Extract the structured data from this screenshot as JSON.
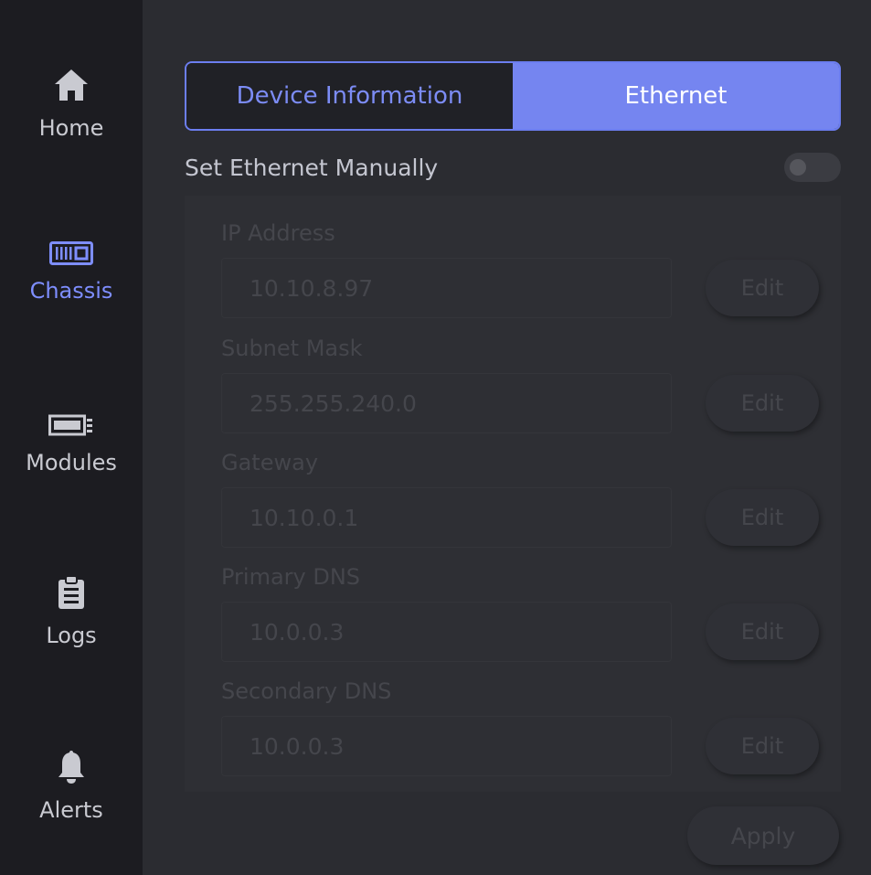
{
  "sidebar": {
    "items": [
      {
        "label": "Home",
        "icon": "home-icon"
      },
      {
        "label": "Chassis",
        "icon": "chassis-icon"
      },
      {
        "label": "Modules",
        "icon": "module-icon"
      },
      {
        "label": "Logs",
        "icon": "clipboard-icon"
      },
      {
        "label": "Alerts",
        "icon": "bell-icon"
      }
    ],
    "active": "Chassis"
  },
  "tabs": [
    {
      "label": "Device Information",
      "active": false
    },
    {
      "label": "Ethernet",
      "active": true
    }
  ],
  "manual": {
    "label": "Set Ethernet Manually",
    "enabled": false
  },
  "fields": [
    {
      "label": "IP Address",
      "value": "10.10.8.97",
      "button": "Edit"
    },
    {
      "label": "Subnet Mask",
      "value": "255.255.240.0",
      "button": "Edit"
    },
    {
      "label": "Gateway",
      "value": "10.10.0.1",
      "button": "Edit"
    },
    {
      "label": "Primary DNS",
      "value": "10.0.0.3",
      "button": "Edit"
    },
    {
      "label": "Secondary DNS",
      "value": "10.0.0.3",
      "button": "Edit"
    }
  ],
  "apply_label": "Apply",
  "colors": {
    "accent": "#7585f0",
    "sidebar": "#1c1c21",
    "background": "#2b2c31"
  }
}
